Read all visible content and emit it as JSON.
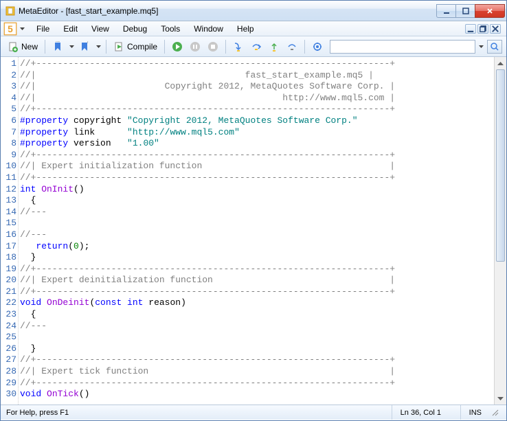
{
  "window": {
    "title": "MetaEditor - [fast_start_example.mq5]"
  },
  "menu": {
    "items": [
      "File",
      "Edit",
      "View",
      "Debug",
      "Tools",
      "Window",
      "Help"
    ]
  },
  "toolbar": {
    "new_label": "New",
    "compile_label": "Compile"
  },
  "search": {
    "value": ""
  },
  "code": {
    "lines": [
      {
        "type": "comment",
        "text": "//+------------------------------------------------------------------+"
      },
      {
        "type": "comment",
        "text": "//|                                       fast_start_example.mq5 |"
      },
      {
        "type": "comment",
        "text": "//|                        Copyright 2012, MetaQuotes Software Corp. |"
      },
      {
        "type": "comment",
        "text": "//|                                              http://www.mql5.com |"
      },
      {
        "type": "comment",
        "text": "//+------------------------------------------------------------------+"
      },
      {
        "type": "prop",
        "kw": "#property",
        "name": " copyright ",
        "val": "\"Copyright 2012, MetaQuotes Software Corp.\""
      },
      {
        "type": "prop",
        "kw": "#property",
        "name": " link      ",
        "val": "\"http://www.mql5.com\""
      },
      {
        "type": "prop",
        "kw": "#property",
        "name": " version   ",
        "val": "\"1.00\""
      },
      {
        "type": "comment",
        "text": "//+------------------------------------------------------------------+"
      },
      {
        "type": "comment",
        "text": "//| Expert initialization function                                   |"
      },
      {
        "type": "comment",
        "text": "//+------------------------------------------------------------------+"
      },
      {
        "type": "sig",
        "kw": "int",
        "fn": " OnInit",
        "rest": "()"
      },
      {
        "type": "plain",
        "text": "  {"
      },
      {
        "type": "comment",
        "text": "//---"
      },
      {
        "type": "plain",
        "text": ""
      },
      {
        "type": "comment",
        "text": "//---"
      },
      {
        "type": "ret",
        "pre": "   ",
        "kw": "return",
        "rest": "(",
        "num": "0",
        "tail": ");"
      },
      {
        "type": "plain",
        "text": "  }"
      },
      {
        "type": "comment",
        "text": "//+------------------------------------------------------------------+"
      },
      {
        "type": "comment",
        "text": "//| Expert deinitialization function                                 |"
      },
      {
        "type": "comment",
        "text": "//+------------------------------------------------------------------+"
      },
      {
        "type": "sig2",
        "kw1": "void",
        "fn": " OnDeinit",
        "rest1": "(",
        "kw2": "const int",
        "rest2": " reason)"
      },
      {
        "type": "plain",
        "text": "  {"
      },
      {
        "type": "comment",
        "text": "//---"
      },
      {
        "type": "plain",
        "text": ""
      },
      {
        "type": "plain",
        "text": "  }"
      },
      {
        "type": "comment",
        "text": "//+------------------------------------------------------------------+"
      },
      {
        "type": "comment",
        "text": "//| Expert tick function                                             |"
      },
      {
        "type": "comment",
        "text": "//+------------------------------------------------------------------+"
      },
      {
        "type": "sig",
        "kw": "void",
        "fn": " OnTick",
        "rest": "()"
      }
    ]
  },
  "status": {
    "help": "For Help, press F1",
    "pos": "Ln 36, Col 1",
    "mode": "INS"
  }
}
